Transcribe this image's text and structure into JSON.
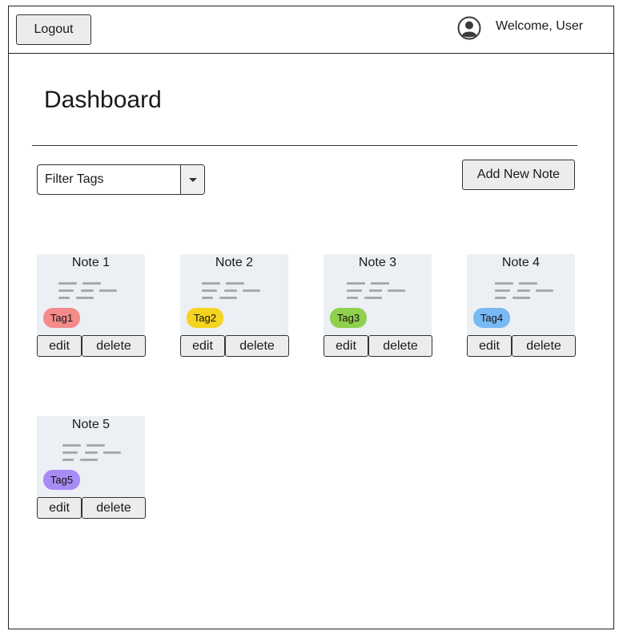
{
  "header": {
    "logout_label": "Logout",
    "welcome_text": "Welcome, User",
    "avatar_icon": "user-circle-icon"
  },
  "main": {
    "title": "Dashboard",
    "filter": {
      "selected": "Filter Tags",
      "arrow_icon": "caret-down-icon"
    },
    "add_note_label": "Add New Note"
  },
  "notes": [
    {
      "title": "Note 1",
      "tag": "Tag1",
      "tag_color": "#f48a8a",
      "edit_label": "edit",
      "delete_label": "delete"
    },
    {
      "title": "Note 2",
      "tag": "Tag2",
      "tag_color": "#f5d31f",
      "edit_label": "edit",
      "delete_label": "delete"
    },
    {
      "title": "Note 3",
      "tag": "Tag3",
      "tag_color": "#8fd04c",
      "edit_label": "edit",
      "delete_label": "delete"
    },
    {
      "title": "Note 4",
      "tag": "Tag4",
      "tag_color": "#78b9f5",
      "edit_label": "edit",
      "delete_label": "delete"
    },
    {
      "title": "Note 5",
      "tag": "Tag5",
      "tag_color": "#a98bf5",
      "edit_label": "edit",
      "delete_label": "delete"
    }
  ],
  "colors": {
    "card_bg": "#eceff4",
    "button_bg": "#ececec",
    "border": "#333333"
  }
}
